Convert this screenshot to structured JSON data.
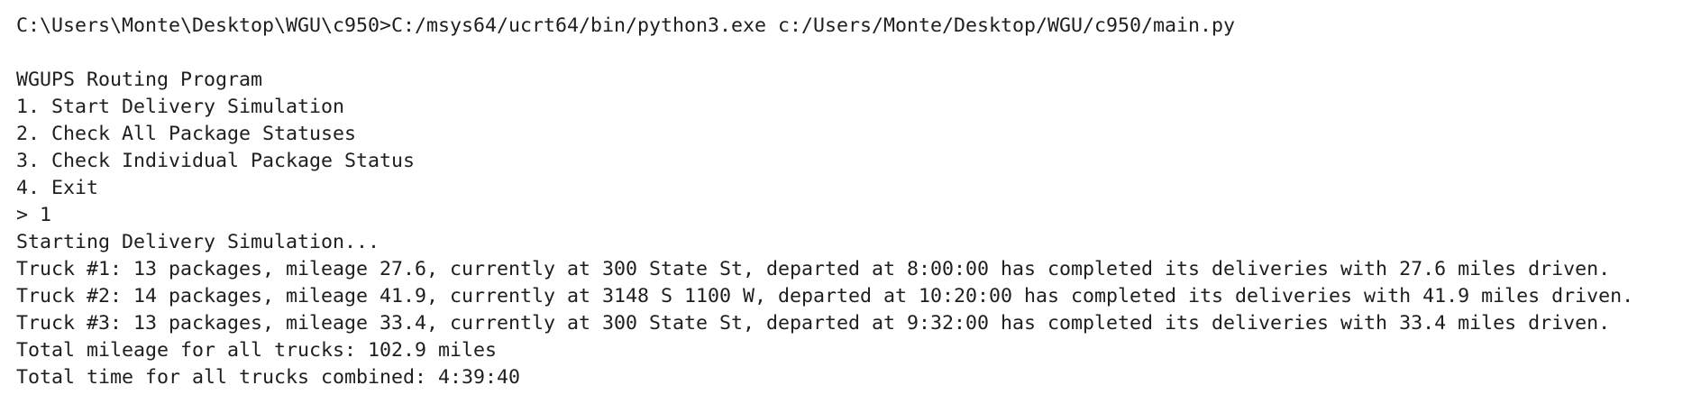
{
  "terminal": {
    "command_line": "C:\\Users\\Monte\\Desktop\\WGU\\c950>C:/msys64/ucrt64/bin/python3.exe c:/Users/Monte/Desktop/WGU/c950/main.py",
    "menu": {
      "title": "WGUPS Routing Program",
      "options": [
        "1. Start Delivery Simulation",
        "2. Check All Package Statuses",
        "3. Check Individual Package Status",
        "4. Exit"
      ]
    },
    "prompt_input": "> 1",
    "output": {
      "starting": "Starting Delivery Simulation...",
      "trucks": [
        "Truck #1: 13 packages, mileage 27.6, currently at 300 State St, departed at 8:00:00 has completed its deliveries with 27.6 miles driven.",
        "Truck #2: 14 packages, mileage 41.9, currently at 3148 S 1100 W, departed at 10:20:00 has completed its deliveries with 41.9 miles driven.",
        "Truck #3: 13 packages, mileage 33.4, currently at 300 State St, departed at 9:32:00 has completed its deliveries with 33.4 miles driven."
      ],
      "total_mileage": "Total mileage for all trucks: 102.9 miles",
      "total_time": "Total time for all trucks combined: 4:39:40"
    },
    "colors": {
      "background": "#ffffff",
      "text": "#1e1e1e"
    }
  }
}
